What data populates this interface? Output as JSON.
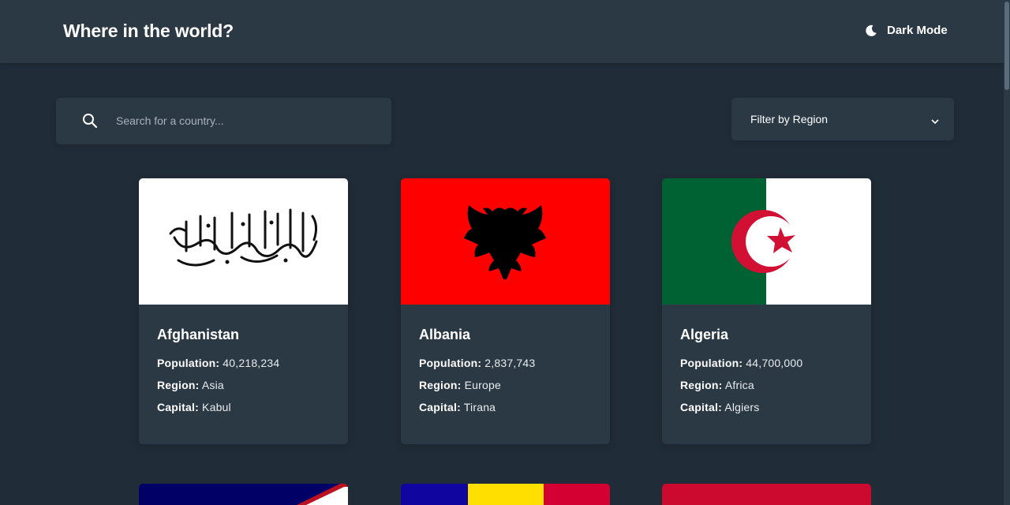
{
  "header": {
    "title": "Where in the world?",
    "theme_toggle_label": "Dark Mode"
  },
  "search": {
    "placeholder": "Search for a country..."
  },
  "filter": {
    "label": "Filter by Region"
  },
  "labels": {
    "population": "Population:",
    "region": "Region:",
    "capital": "Capital:"
  },
  "countries": [
    {
      "name": "Afghanistan",
      "population": "40,218,234",
      "region": "Asia",
      "capital": "Kabul"
    },
    {
      "name": "Albania",
      "population": "2,837,743",
      "region": "Europe",
      "capital": "Tirana"
    },
    {
      "name": "Algeria",
      "population": "44,700,000",
      "region": "Africa",
      "capital": "Algiers"
    }
  ],
  "colors": {
    "background": "#202c37",
    "surface": "#2b3945",
    "text": "#ffffff"
  }
}
